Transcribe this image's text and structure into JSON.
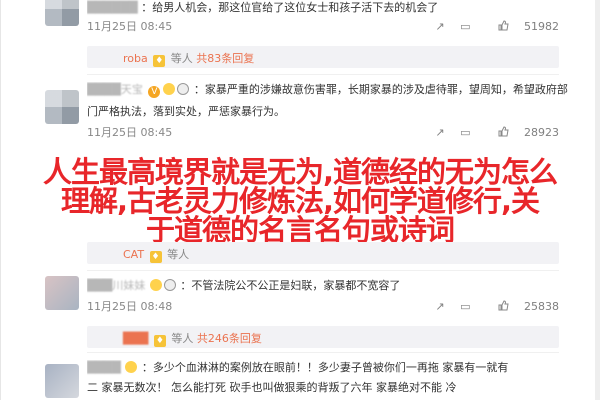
{
  "posts": [
    {
      "line1": "：给男人机会，那这位官给了这位女士和孩子活下去的机会了",
      "date": "11月25日 08:45",
      "share": "",
      "comment": "",
      "likes": "51982"
    },
    {
      "sub_user": "roba",
      "sub_text": "等人",
      "sub_count": "共83条回复",
      "colors": {
        "accent": "#eb7350"
      }
    },
    {
      "line1": "：家暴严重的涉嫌故意伤害罪，长期家暴的涉及虐待罪，望周知，希望政府部",
      "line2": "门严格执法，落到实处，严惩家暴行为。",
      "date": "11月25日 08:45",
      "likes": "28923"
    },
    {
      "sub_user": "CAT",
      "sub_text": "等人"
    },
    {
      "line1": "：不管法院公不公正是妇联，家暴都不宽容了",
      "date": "11月25日 08:48",
      "likes": "25838"
    },
    {
      "sub_text": "等人",
      "sub_count": "共246条回复"
    },
    {
      "line1": "：多少个血淋淋的案例放在眼前！！多少妻子曾被你们一再拖 家暴有一就有",
      "line2": "二 家暴无数次！ 怎么能打死 砍手也叫做狠乘的背叛了六年  家暴绝对不能 冷"
    }
  ],
  "headline": {
    "line1": "人生最高境界就是无为,道德经的无为怎么",
    "line2": "理解,古老灵力修炼法,如何学道修行,关",
    "line3": "于道德的名言名句或诗词"
  },
  "colors": {
    "headline": "#e8262a",
    "username": "#eb7350",
    "meta": "#888888"
  }
}
